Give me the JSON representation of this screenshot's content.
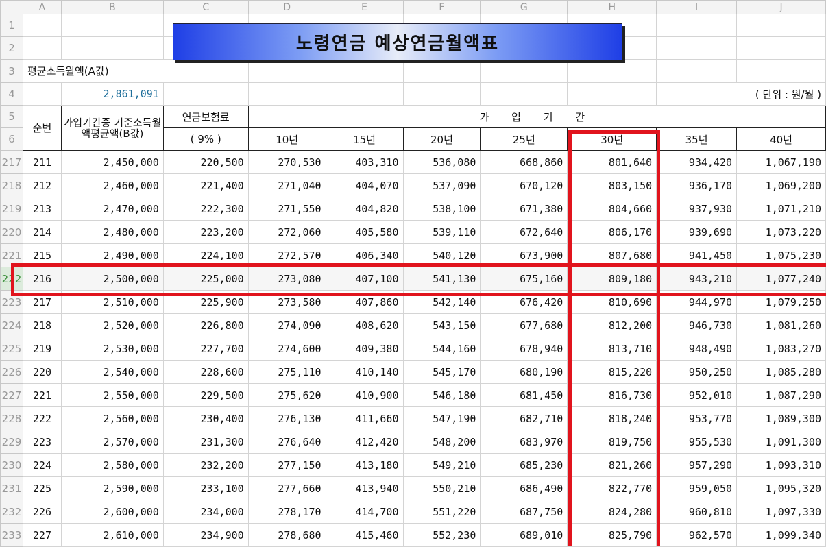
{
  "title": "노령연금 예상연금월액표",
  "columns": [
    "A",
    "B",
    "C",
    "D",
    "E",
    "F",
    "G",
    "H",
    "I",
    "J"
  ],
  "top_row_numbers": [
    "1",
    "2",
    "3",
    "4",
    "5",
    "6"
  ],
  "avg_income_label": "평균소득월액(A값)",
  "avg_income_value": "2,861,091",
  "unit_label": "( 단위 : 원/월 )",
  "headers": {
    "seq": "순번",
    "base_income": "가입기간중 기준소득월액평균액(B값)",
    "premium": "연금보험료",
    "premium_rate": "( 9% )",
    "period": "가 입 기 간",
    "years": [
      "10년",
      "15년",
      "20년",
      "25년",
      "30년",
      "35년",
      "40년"
    ]
  },
  "highlight": {
    "row_seq": "216",
    "column": "30년",
    "color": "#e1141d"
  },
  "rows": [
    {
      "row": "217",
      "seq": "211",
      "base": "2,450,000",
      "premium": "220,500",
      "y10": "270,530",
      "y15": "403,310",
      "y20": "536,080",
      "y25": "668,860",
      "y30": "801,640",
      "y35": "934,420",
      "y40": "1,067,190"
    },
    {
      "row": "218",
      "seq": "212",
      "base": "2,460,000",
      "premium": "221,400",
      "y10": "271,040",
      "y15": "404,070",
      "y20": "537,090",
      "y25": "670,120",
      "y30": "803,150",
      "y35": "936,170",
      "y40": "1,069,200"
    },
    {
      "row": "219",
      "seq": "213",
      "base": "2,470,000",
      "premium": "222,300",
      "y10": "271,550",
      "y15": "404,820",
      "y20": "538,100",
      "y25": "671,380",
      "y30": "804,660",
      "y35": "937,930",
      "y40": "1,071,210"
    },
    {
      "row": "220",
      "seq": "214",
      "base": "2,480,000",
      "premium": "223,200",
      "y10": "272,060",
      "y15": "405,580",
      "y20": "539,110",
      "y25": "672,640",
      "y30": "806,170",
      "y35": "939,690",
      "y40": "1,073,220"
    },
    {
      "row": "221",
      "seq": "215",
      "base": "2,490,000",
      "premium": "224,100",
      "y10": "272,570",
      "y15": "406,340",
      "y20": "540,120",
      "y25": "673,900",
      "y30": "807,680",
      "y35": "941,450",
      "y40": "1,075,230"
    },
    {
      "row": "222",
      "seq": "216",
      "base": "2,500,000",
      "premium": "225,000",
      "y10": "273,080",
      "y15": "407,100",
      "y20": "541,130",
      "y25": "675,160",
      "y30": "809,180",
      "y35": "943,210",
      "y40": "1,077,240"
    },
    {
      "row": "223",
      "seq": "217",
      "base": "2,510,000",
      "premium": "225,900",
      "y10": "273,580",
      "y15": "407,860",
      "y20": "542,140",
      "y25": "676,420",
      "y30": "810,690",
      "y35": "944,970",
      "y40": "1,079,250"
    },
    {
      "row": "224",
      "seq": "218",
      "base": "2,520,000",
      "premium": "226,800",
      "y10": "274,090",
      "y15": "408,620",
      "y20": "543,150",
      "y25": "677,680",
      "y30": "812,200",
      "y35": "946,730",
      "y40": "1,081,260"
    },
    {
      "row": "225",
      "seq": "219",
      "base": "2,530,000",
      "premium": "227,700",
      "y10": "274,600",
      "y15": "409,380",
      "y20": "544,160",
      "y25": "678,940",
      "y30": "813,710",
      "y35": "948,490",
      "y40": "1,083,270"
    },
    {
      "row": "226",
      "seq": "220",
      "base": "2,540,000",
      "premium": "228,600",
      "y10": "275,110",
      "y15": "410,140",
      "y20": "545,170",
      "y25": "680,190",
      "y30": "815,220",
      "y35": "950,250",
      "y40": "1,085,280"
    },
    {
      "row": "227",
      "seq": "221",
      "base": "2,550,000",
      "premium": "229,500",
      "y10": "275,620",
      "y15": "410,900",
      "y20": "546,180",
      "y25": "681,450",
      "y30": "816,730",
      "y35": "952,010",
      "y40": "1,087,290"
    },
    {
      "row": "228",
      "seq": "222",
      "base": "2,560,000",
      "premium": "230,400",
      "y10": "276,130",
      "y15": "411,660",
      "y20": "547,190",
      "y25": "682,710",
      "y30": "818,240",
      "y35": "953,770",
      "y40": "1,089,300"
    },
    {
      "row": "229",
      "seq": "223",
      "base": "2,570,000",
      "premium": "231,300",
      "y10": "276,640",
      "y15": "412,420",
      "y20": "548,200",
      "y25": "683,970",
      "y30": "819,750",
      "y35": "955,530",
      "y40": "1,091,300"
    },
    {
      "row": "230",
      "seq": "224",
      "base": "2,580,000",
      "premium": "232,200",
      "y10": "277,150",
      "y15": "413,180",
      "y20": "549,210",
      "y25": "685,230",
      "y30": "821,260",
      "y35": "957,290",
      "y40": "1,093,310"
    },
    {
      "row": "231",
      "seq": "225",
      "base": "2,590,000",
      "premium": "233,100",
      "y10": "277,660",
      "y15": "413,940",
      "y20": "550,210",
      "y25": "686,490",
      "y30": "822,770",
      "y35": "959,050",
      "y40": "1,095,320"
    },
    {
      "row": "232",
      "seq": "226",
      "base": "2,600,000",
      "premium": "234,000",
      "y10": "278,170",
      "y15": "414,700",
      "y20": "551,220",
      "y25": "687,750",
      "y30": "824,280",
      "y35": "960,810",
      "y40": "1,097,330"
    },
    {
      "row": "233",
      "seq": "227",
      "base": "2,610,000",
      "premium": "234,900",
      "y10": "278,680",
      "y15": "415,460",
      "y20": "552,230",
      "y25": "689,010",
      "y30": "825,790",
      "y35": "962,570",
      "y40": "1,099,340"
    }
  ]
}
